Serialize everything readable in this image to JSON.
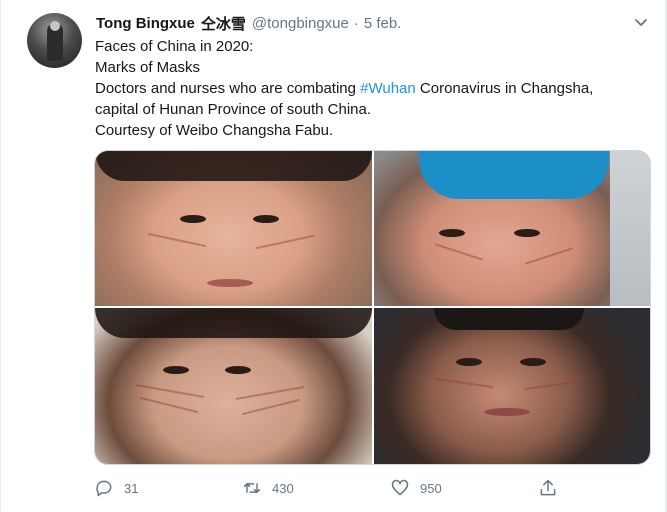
{
  "tweet": {
    "author_name": "Tong Bingxue",
    "author_name_cn": "仝冰雪",
    "handle": "@tongbingxue",
    "separator": "·",
    "date": "5 feb.",
    "text_lines": {
      "l1": "Faces of  China in 2020:",
      "l2": "Marks of Masks",
      "l3_before": "Doctors and nurses who are combating ",
      "l3_hashtag": "#Wuhan",
      "l3_after": " Coronavirus in Changsha,",
      "l4": "capital of Hunan Province of south China.",
      "l5": "Courtesy of Weibo Changsha Fabu."
    },
    "colors": {
      "link": "#1b95e0",
      "secondary": "#657786"
    },
    "actions": {
      "replies": "31",
      "retweets": "430",
      "likes": "950"
    },
    "icons": {
      "more": "chevron-down-icon",
      "reply": "reply-icon",
      "retweet": "retweet-icon",
      "like": "heart-icon",
      "share": "share-icon"
    }
  }
}
